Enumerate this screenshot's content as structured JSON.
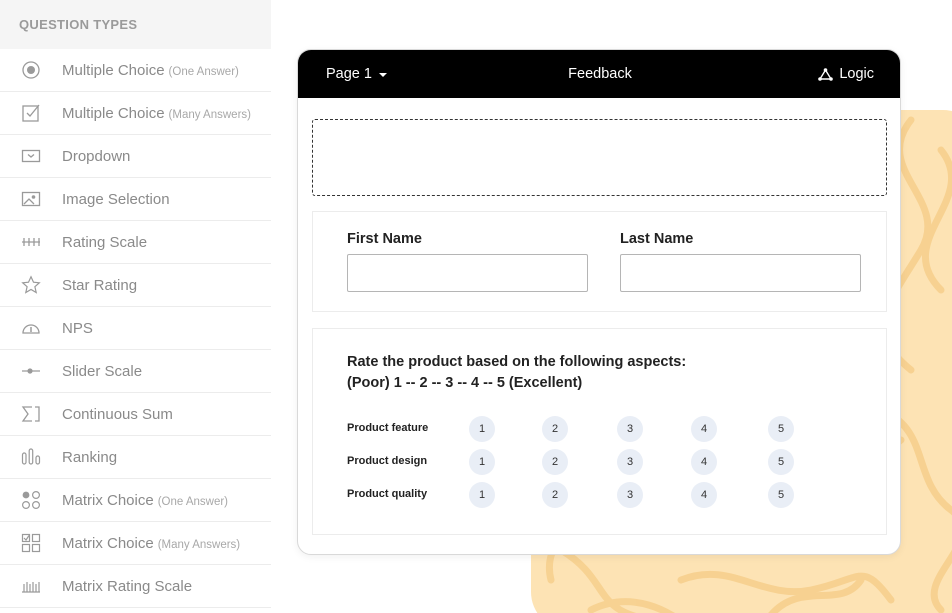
{
  "sidebar": {
    "header": "QUESTION TYPES",
    "items": [
      {
        "label": "Multiple Choice",
        "sub": "(One Answer)",
        "icon": "radio-icon"
      },
      {
        "label": "Multiple Choice",
        "sub": "(Many Answers)",
        "icon": "checkbox-icon"
      },
      {
        "label": "Dropdown",
        "sub": "",
        "icon": "dropdown-icon"
      },
      {
        "label": "Image Selection",
        "sub": "",
        "icon": "image-icon"
      },
      {
        "label": "Rating Scale",
        "sub": "",
        "icon": "rating-scale-icon"
      },
      {
        "label": "Star Rating",
        "sub": "",
        "icon": "star-icon"
      },
      {
        "label": "NPS",
        "sub": "",
        "icon": "gauge-icon"
      },
      {
        "label": "Slider Scale",
        "sub": "",
        "icon": "slider-icon"
      },
      {
        "label": "Continuous Sum",
        "sub": "",
        "icon": "sum-icon"
      },
      {
        "label": "Ranking",
        "sub": "",
        "icon": "ranking-icon"
      },
      {
        "label": "Matrix Choice",
        "sub": "(One Answer)",
        "icon": "matrix-radio-icon"
      },
      {
        "label": "Matrix Choice",
        "sub": "(Many Answers)",
        "icon": "matrix-checkbox-icon"
      },
      {
        "label": "Matrix Rating Scale",
        "sub": "",
        "icon": "matrix-rating-icon"
      }
    ]
  },
  "form": {
    "page_label": "Page 1",
    "title": "Feedback",
    "logic_label": "Logic",
    "first_name_label": "First Name",
    "last_name_label": "Last Name",
    "rating_question_line1": "Rate the product based on the following aspects:",
    "rating_question_line2": "(Poor) 1 -- 2 -- 3 -- 4 -- 5 (Excellent)",
    "rows": [
      {
        "label": "Product feature",
        "options": [
          "1",
          "2",
          "3",
          "4",
          "5"
        ]
      },
      {
        "label": "Product design",
        "options": [
          "1",
          "2",
          "3",
          "4",
          "5"
        ]
      },
      {
        "label": "Product quality",
        "options": [
          "1",
          "2",
          "3",
          "4",
          "5"
        ]
      }
    ]
  },
  "colors": {
    "topbar": "#000000",
    "blob": "#fde3b4",
    "option_bg": "#e9eef6",
    "sidebar_text": "#8a8a8a"
  }
}
